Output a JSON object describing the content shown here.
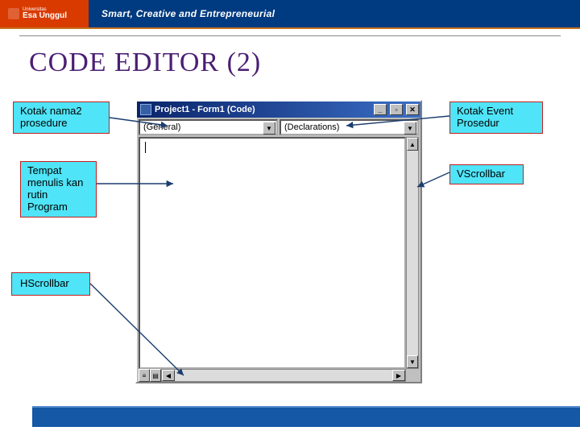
{
  "banner": {
    "brand_small": "Universitas",
    "brand": "Esa Unggul",
    "tagline": "Smart, Creative and Entrepreneurial"
  },
  "slide": {
    "title": "CODE  EDITOR (2)"
  },
  "editor": {
    "title": "Project1 - Form1 (Code)",
    "combo_left": "(General)",
    "combo_right": "(Declarations)",
    "btn_min": "_",
    "btn_max": "▫",
    "btn_close": "✕",
    "arrow": "▼",
    "arrow_up": "▲",
    "arrow_left": "◀",
    "arrow_right": "▶"
  },
  "callouts": {
    "nama": "Kotak nama2 prosedure",
    "event": "Kotak Event Prosedur",
    "tempat": "Tempat menulis kan rutin Program",
    "vscroll": "VScrollbar",
    "hscroll": "HScrollbar"
  }
}
